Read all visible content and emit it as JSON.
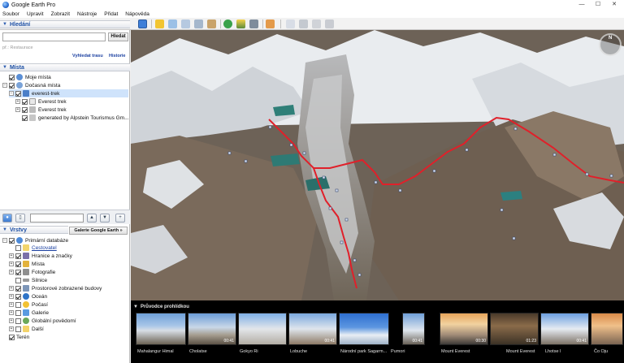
{
  "window": {
    "title": "Google Earth Pro"
  },
  "menubar": [
    "Soubor",
    "Upravit",
    "Zobrazit",
    "Nástroje",
    "Přidat",
    "Nápověda"
  ],
  "search": {
    "header": "Hledání",
    "button": "Hledat",
    "hint": "př.: Restaurace",
    "links": [
      "Vyhledat trasu",
      "Historie"
    ]
  },
  "places": {
    "header": "Místa",
    "items": [
      {
        "label": "Moje místa"
      },
      {
        "label": "Dočasná místa"
      },
      {
        "label": "everest-trek"
      },
      {
        "label": "Everest trek"
      },
      {
        "label": "Everest trek"
      },
      {
        "label": "generated by Alpstein Tourismus Gm..."
      }
    ]
  },
  "layers": {
    "header": "Vrstvy",
    "gallery_button": "Galerie Google Earth",
    "gallery_arrow": "»",
    "items": [
      {
        "label": "Primární databáze"
      },
      {
        "label": "Cestovatel"
      },
      {
        "label": "Hranice a značky"
      },
      {
        "label": "Místa"
      },
      {
        "label": "Fotografie"
      },
      {
        "label": "Silnice"
      },
      {
        "label": "Prostorové zobrazené budovy"
      },
      {
        "label": "Oceán"
      },
      {
        "label": "Počasí"
      },
      {
        "label": "Galerie"
      },
      {
        "label": "Globální povědomí"
      },
      {
        "label": "Další"
      },
      {
        "label": "Terén"
      }
    ]
  },
  "tour_guide": {
    "header": "Průvodce prohlídkou",
    "items": [
      {
        "label": "Mahalangur Himal",
        "duration": ""
      },
      {
        "label": "Cholatse",
        "duration": "00:41"
      },
      {
        "label": "Gokyo Ri",
        "duration": ""
      },
      {
        "label": "Lobuche",
        "duration": "00:41"
      },
      {
        "label": "Národní park Sagarm...",
        "duration": ""
      },
      {
        "label": "Pumori",
        "duration": "00:41"
      },
      {
        "label": "Mount Everest",
        "duration": "00:30"
      },
      {
        "label": "Mount Everest",
        "duration": "01:23"
      },
      {
        "label": "Lhotse I",
        "duration": "00:41"
      },
      {
        "label": "Čo Oju",
        "duration": ""
      }
    ]
  },
  "colors": {
    "route": "#e0202a",
    "panel_header_text": "#1d4fa4",
    "tour_bg": "#000000"
  }
}
